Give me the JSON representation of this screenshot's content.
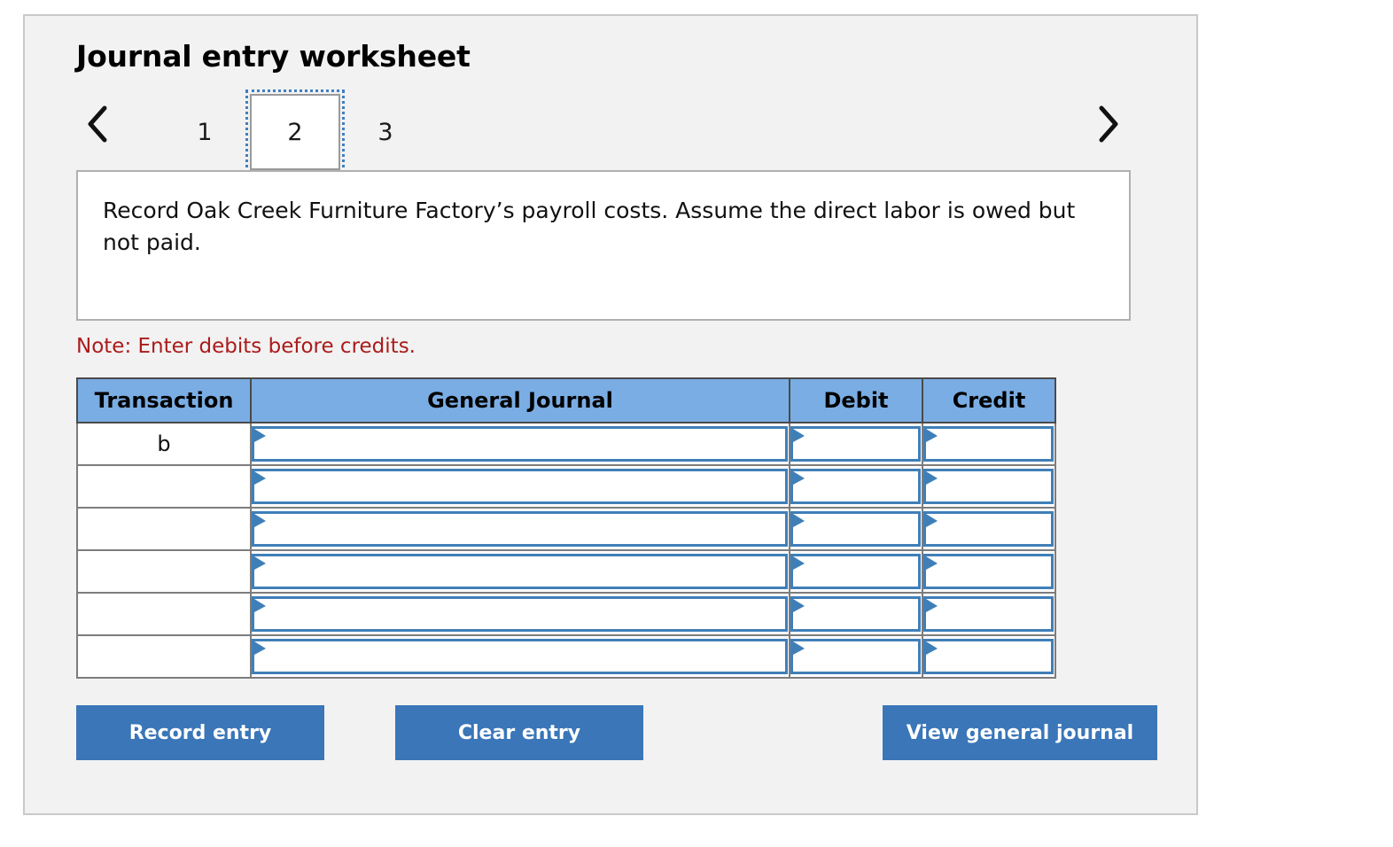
{
  "panel": {
    "title": "Journal entry worksheet"
  },
  "pager": {
    "prev_icon": "chevron-left-icon",
    "next_icon": "chevron-right-icon",
    "pages": [
      {
        "label": "1",
        "active": false
      },
      {
        "label": "2",
        "active": true
      },
      {
        "label": "3",
        "active": false
      }
    ]
  },
  "description": {
    "text": "Record Oak Creek Furniture Factory’s payroll costs. Assume the direct labor is owed but not paid."
  },
  "note": {
    "text": "Note: Enter debits before credits."
  },
  "table": {
    "headers": {
      "transaction": "Transaction",
      "general_journal": "General Journal",
      "debit": "Debit",
      "credit": "Credit"
    },
    "rows": [
      {
        "transaction": "b",
        "general_journal": "",
        "debit": "",
        "credit": ""
      },
      {
        "transaction": "",
        "general_journal": "",
        "debit": "",
        "credit": ""
      },
      {
        "transaction": "",
        "general_journal": "",
        "debit": "",
        "credit": ""
      },
      {
        "transaction": "",
        "general_journal": "",
        "debit": "",
        "credit": ""
      },
      {
        "transaction": "",
        "general_journal": "",
        "debit": "",
        "credit": ""
      },
      {
        "transaction": "",
        "general_journal": "",
        "debit": "",
        "credit": ""
      }
    ]
  },
  "buttons": {
    "record": "Record entry",
    "clear": "Clear entry",
    "view": "View general journal"
  },
  "colors": {
    "header_blue": "#7aade3",
    "button_blue": "#3a76b8",
    "note_red": "#ab1b1b",
    "panel_bg": "#f2f2f2",
    "input_border_blue": "#3f7fb8"
  }
}
